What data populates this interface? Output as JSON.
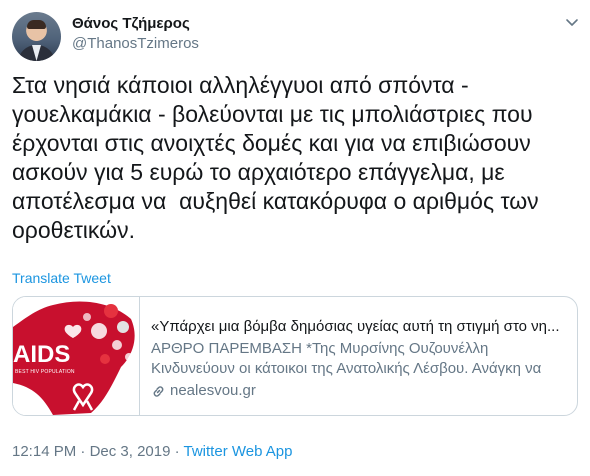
{
  "author": {
    "name": "Θάνος Τζήμερος",
    "handle": "@ThanosTzimeros"
  },
  "tweet": {
    "text": "Στα νησιά κάποιοι αλληλέγγυοι από σπόντα -\nγουελκαμάκια - βολεύονται με τις μπολιάστριες που\nέρχονται στις ανοιχτές δομές και για να επιβιώσουν\nασκούν για 5 ευρώ το αρχαιότερο επάγγελμα, με\nαποτέλεσμα να  αυξηθεί κατακόρυφα ο αριθμός των\nοροθετικών.",
    "translate_label": "Translate Tweet"
  },
  "card": {
    "thumb_text": "AIDS",
    "thumb_subtext": "BEST HIV POPULATION",
    "title": "«Υπάρχει μια βόμβα δημόσιας υγείας αυτή τη στιγμή στο νη...",
    "description": "ΑΡΘΡΟ ΠΑΡΕΜΒΑΣΗ *Της Μυρσίνης Ουζουνέλλη Κινδυνεύουν οι κάτοικοι της Ανατολικής Λέσβου. Ανάγκη να ελεγχθεί ...",
    "domain": "nealesvou.gr"
  },
  "meta": {
    "time": "12:14 PM",
    "sep1": " · ",
    "date": "Dec 3, 2019",
    "sep2": " · ",
    "source": "Twitter Web App"
  },
  "colors": {
    "link": "#1b95e0",
    "secondary_text": "#657786",
    "aids_red": "#c8102e"
  },
  "icons": {
    "caret": "chevron-down-icon",
    "link": "link-icon",
    "ribbon": "ribbon-icon"
  }
}
